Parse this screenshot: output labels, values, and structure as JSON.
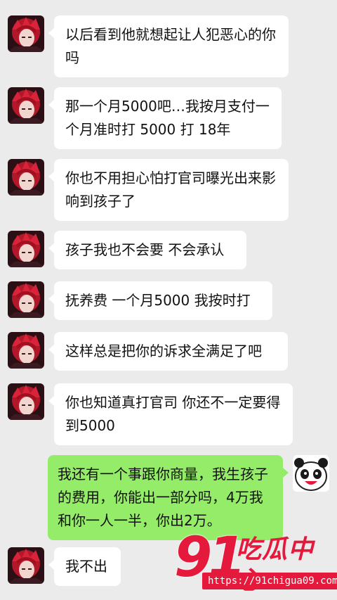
{
  "conversation": {
    "messages": [
      {
        "sender": "contact",
        "text": "以后看到他就想起让人犯恶心的你吗"
      },
      {
        "sender": "contact",
        "text": "那一个月5000吧…我按月支付一个月准时打 5000 打 18年"
      },
      {
        "sender": "contact",
        "text": "你也不用担心怕打官司曝光出来影响到孩子了"
      },
      {
        "sender": "contact",
        "text": "孩子我也不会要 不会承认"
      },
      {
        "sender": "contact",
        "text": "抚养费 一个月5000 我按时打"
      },
      {
        "sender": "contact",
        "text": "这样总是把你的诉求全满足了吧"
      },
      {
        "sender": "contact",
        "text": "你也知道真打官司 你还不一定要得到5000"
      },
      {
        "sender": "self",
        "text": "我还有一个事跟你商量，我生孩子的费用，你能出一部分吗，4万我和你一人一半，你出2万。"
      },
      {
        "sender": "contact",
        "text": "我不出"
      }
    ]
  },
  "watermark": {
    "number": "91",
    "brand": "吃瓜中心",
    "url": "https://91chigua09.com"
  },
  "colors": {
    "background": "#ebebeb",
    "incoming_bubble": "#ffffff",
    "outgoing_bubble": "#95ec69",
    "watermark": "#e5193b"
  }
}
